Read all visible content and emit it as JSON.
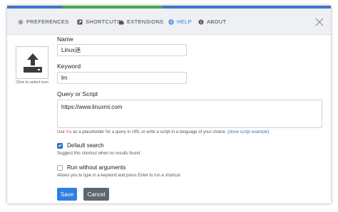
{
  "colors": {
    "accent": "#3a7fd5",
    "placeholder_highlight": "#e0457b",
    "stripes": [
      "#3f76c7",
      "#47a94b",
      "#3f76c7"
    ]
  },
  "tabs": [
    {
      "label": "PREFERENCES",
      "icon": "gear-icon",
      "active": false
    },
    {
      "label": "SHORTCUTS",
      "icon": "shortcut-icon",
      "active": false
    },
    {
      "label": "EXTENSIONS",
      "icon": "puzzle-icon",
      "active": false
    },
    {
      "label": "HELP",
      "icon": "help-icon",
      "active": true
    },
    {
      "label": "ABOUT",
      "icon": "info-icon",
      "active": false
    }
  ],
  "form": {
    "icon_caption": "Click to select icon",
    "name_label": "Name",
    "name_value": "Linux迷",
    "keyword_label": "Keyword",
    "keyword_value": "lm",
    "query_label": "Query or Script",
    "query_value": "https://www.linuxmi.com",
    "hint_prefix": "Use",
    "hint_placeholder": "%s",
    "hint_middle": "as a placeholder for a query in URL or write a script in a language of your choice.",
    "hint_link": "(show script example)",
    "default_search_label": "Default search",
    "default_search_checked": true,
    "default_search_hint": "Suggest this shortcut when no results found",
    "run_without_args_label": "Run without arguments",
    "run_without_args_checked": false,
    "run_without_args_hint": "Allows you to type in a keyword and press Enter to run a shortcut",
    "save_label": "Save",
    "cancel_label": "Cancel"
  }
}
